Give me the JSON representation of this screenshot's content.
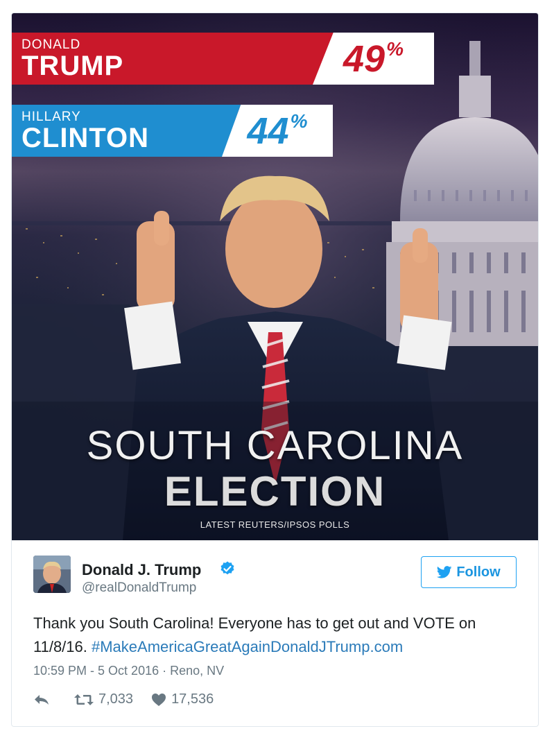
{
  "poster": {
    "candidates": [
      {
        "first": "DONALD",
        "last": "TRUMP",
        "percent": "49",
        "percent_sign": "%",
        "color": "#c9182a"
      },
      {
        "first": "HILLARY",
        "last": "CLINTON",
        "percent": "44",
        "percent_sign": "%",
        "color": "#1f8ed0"
      }
    ],
    "headline_state": "SOUTH CAROLINA",
    "headline_event": "ELECTION",
    "subline": "LATEST REUTERS/IPSOS POLLS"
  },
  "tweet": {
    "display_name": "Donald J. Trump",
    "handle": "@realDonaldTrump",
    "follow_label": "Follow",
    "text_main": "Thank you South Carolina! Everyone has to get out and VOTE on 11/8/16. ",
    "hashtag": "#MakeAmericaGreatAgain",
    "link": "DonaldJTrump.com",
    "time": "10:59 PM - 5 Oct 2016",
    "separator": "·",
    "location": "Reno, NV",
    "retweets": "7,033",
    "likes": "17,536",
    "colors": {
      "accent": "#1da1f2",
      "link": "#2b7bb9",
      "muted": "#697882",
      "text": "#1c2022"
    }
  },
  "icons": [
    "verified-badge-icon",
    "twitter-bird-icon",
    "reply-icon",
    "retweet-icon",
    "heart-icon"
  ]
}
